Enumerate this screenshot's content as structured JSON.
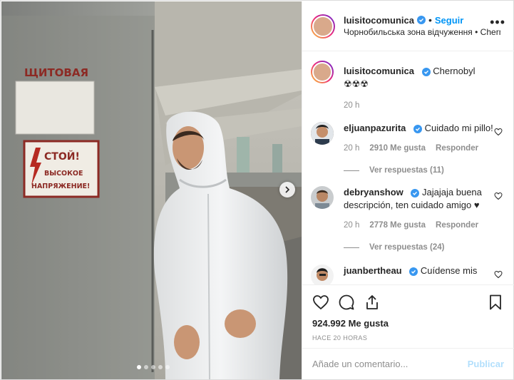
{
  "post": {
    "author": "luisitocomunica",
    "follow_label": "Seguir",
    "separator": "•",
    "location": "Чорнобильська зона відчуження • Chernoby...",
    "more_label": "•••",
    "likes": "924.992 Me gusta",
    "time_ago": "HACE 20 HORAS",
    "photo_sign_top": "ЩИТОВАЯ",
    "photo_sign_warning": [
      "СТОЙ!",
      "ВЫСОКОЕ",
      "НАПРЯЖЕНИЕ!"
    ]
  },
  "caption": {
    "author": "luisitocomunica",
    "text": "Chernobyl ☢☢☢",
    "time": "20 h"
  },
  "comments": [
    {
      "author": "eljuanpazurita",
      "text": "Cuidado mi pillo!",
      "time": "20 h",
      "likes": "2910 Me gusta",
      "reply": "Responder",
      "view_replies": "Ver respuestas (11)"
    },
    {
      "author": "debryanshow",
      "text": "Jajajaja buena descripción, ten cuidado amigo ♥",
      "time": "20 h",
      "likes": "2778 Me gusta",
      "reply": "Responder",
      "view_replies": "Ver respuestas (24)"
    },
    {
      "author": "juanbertheau",
      "text": "Cuídense mis"
    }
  ],
  "composer": {
    "placeholder": "Añade un comentario...",
    "publish_label": "Publicar"
  },
  "carousel": {
    "total": 5,
    "active_index": 0
  },
  "icons": {
    "like": "heart-icon",
    "comment": "comment-icon",
    "share": "share-icon",
    "save": "bookmark-icon",
    "verified": "verified-badge-icon",
    "next": "chevron-right-icon"
  },
  "colors": {
    "link": "#0095f6",
    "verified": "#3897f0",
    "muted": "#8e8e8e",
    "publish_disabled": "#b2dffc"
  }
}
